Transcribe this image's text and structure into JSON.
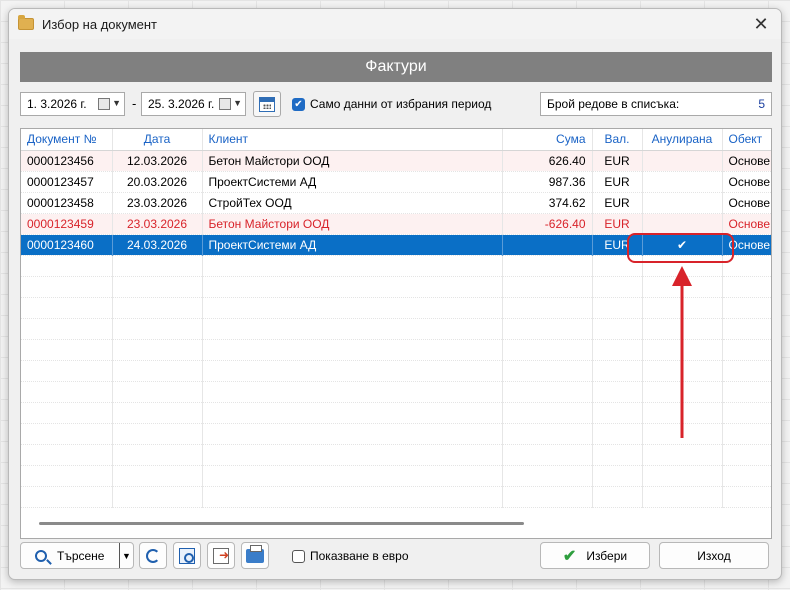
{
  "window": {
    "title": "Избор на документ",
    "close_symbol": "✕"
  },
  "section_title": "Фактури",
  "filters": {
    "date_from": "1.  3.2026 г.",
    "date_to": "25.  3.2026 г.",
    "separator": "-",
    "only_period_label": "Само данни от избрания период",
    "only_period_checked": true,
    "row_count_label": "Брой редове в списъка:",
    "row_count_value": "5"
  },
  "table": {
    "columns": [
      "Документ №",
      "Дата",
      "Клиент",
      "Сума",
      "Вал.",
      "Анулирана",
      "Обект"
    ],
    "rows": [
      {
        "doc": "0000123456",
        "date": "12.03.2026",
        "client": "Бетон Майстори ООД",
        "sum": "626.40",
        "cur": "EUR",
        "annulled": "",
        "object": "Основе",
        "style": "pink"
      },
      {
        "doc": "0000123457",
        "date": "20.03.2026",
        "client": "ПроектСистеми АД",
        "sum": "987.36",
        "cur": "EUR",
        "annulled": "",
        "object": "Основе",
        "style": "normal"
      },
      {
        "doc": "0000123458",
        "date": "23.03.2026",
        "client": "СтройТех ООД",
        "sum": "374.62",
        "cur": "EUR",
        "annulled": "",
        "object": "Основе",
        "style": "normal"
      },
      {
        "doc": "0000123459",
        "date": "23.03.2026",
        "client": "Бетон Майстори ООД",
        "sum": "-626.40",
        "cur": "EUR",
        "annulled": "",
        "object": "Основе",
        "style": "red"
      },
      {
        "doc": "0000123460",
        "date": "24.03.2026",
        "client": "ПроектСистеми АД",
        "sum": "",
        "cur": "EUR",
        "annulled": "✔",
        "object": "Основе",
        "style": "selected"
      }
    ]
  },
  "toolbar": {
    "search_label": "Търсене",
    "show_euro_label": "Показване в евро",
    "show_euro_checked": false,
    "select_label": "Избери",
    "exit_label": "Изход"
  },
  "colors": {
    "accent": "#1f6bc4",
    "selection": "#0a6fc6",
    "annotation": "#d8232a",
    "header_bar": "#808080"
  }
}
